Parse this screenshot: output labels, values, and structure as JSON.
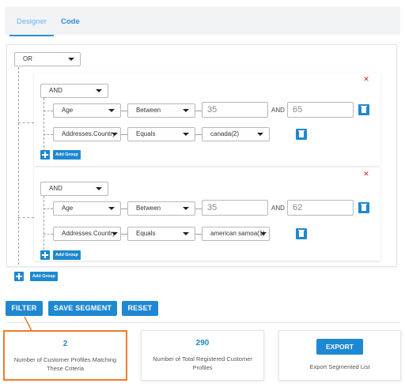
{
  "tabs": [
    {
      "label": "Designer",
      "active": true
    },
    {
      "label": "Code",
      "active": false
    }
  ],
  "root": {
    "operator": "OR",
    "add_group_label": "Add Group"
  },
  "groups": [
    {
      "operator": "AND",
      "rules": [
        {
          "field": "Age",
          "condition": "Between",
          "value_from": "35",
          "and_label": "AND",
          "value_to": "65"
        },
        {
          "field": "Addresses.Country",
          "condition": "Equals",
          "value": "canada(2)"
        }
      ],
      "add_group_label": "Add Group"
    },
    {
      "operator": "AND",
      "rules": [
        {
          "field": "Age",
          "condition": "Between",
          "value_from": "35",
          "and_label": "AND",
          "value_to": "62"
        },
        {
          "field": "Addresses.Country",
          "condition": "Equals",
          "value": "american samoa(1)"
        }
      ],
      "add_group_label": "Add Group"
    }
  ],
  "actions": {
    "filter": "FILTER",
    "save_segment": "SAVE SEGMENT",
    "reset": "RESET"
  },
  "stats": {
    "matching_count": "2",
    "matching_label": "Number of Customer Profiles Matching These Criteria",
    "total_count": "290",
    "total_label": "Number of Total Registered Customer Profiles",
    "export_button": "EXPORT",
    "export_label": "Export Segmented List"
  },
  "colors": {
    "accent": "#1e88d2",
    "delete": "#d2232a",
    "highlight": "#ee7b2a"
  }
}
